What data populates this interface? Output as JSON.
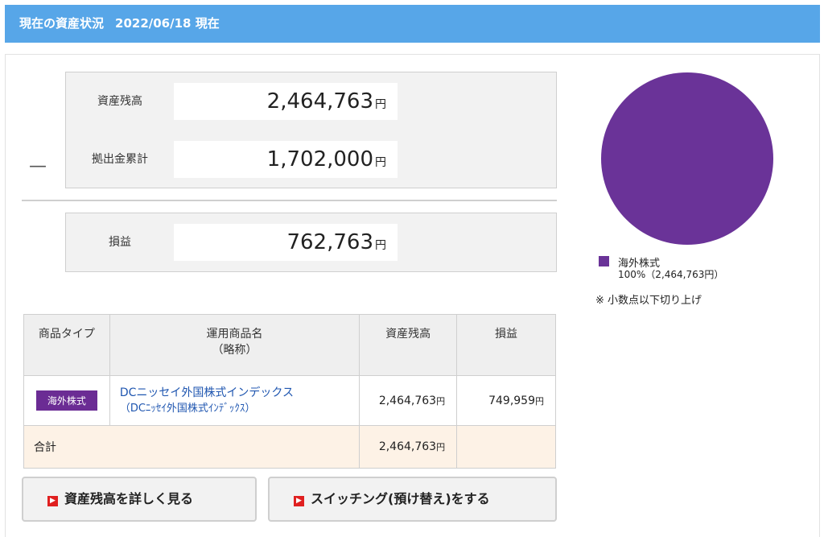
{
  "header": {
    "title": "現在の資産状況",
    "date": "2022/06/18 現在"
  },
  "summary": {
    "balance_label": "資産残高",
    "balance_value": "2,464,763",
    "contrib_label": "拠出金累計",
    "contrib_value": "1,702,000",
    "minus_sign": "—",
    "profit_label": "損益",
    "profit_value": "762,763",
    "yen": "円"
  },
  "table": {
    "headers": {
      "type": "商品タイプ",
      "name": "運用商品名",
      "name_sub": "（略称）",
      "balance": "資産残高",
      "profit": "損益"
    },
    "row": {
      "type_badge": "海外株式",
      "name": "DCニッセイ外国株式インデックス",
      "short": "（DCﾆｯｾｲ外国株式ｲﾝﾃﾞｯｸｽ）",
      "balance": "2,464,763",
      "profit": "749,959"
    },
    "total": {
      "label": "合計",
      "balance": "2,464,763"
    },
    "yen": "円"
  },
  "buttons": {
    "detail": "資産残高を詳しく見る",
    "switching": "スイッチング(預け替え)をする",
    "arrow": "▶"
  },
  "chart_data": {
    "type": "pie",
    "slices": [
      {
        "name": "海外株式",
        "value": 100,
        "label": "100%（2,464,763円）",
        "color": "#6a3398"
      }
    ],
    "note": "※ 小数点以下切り上げ"
  }
}
